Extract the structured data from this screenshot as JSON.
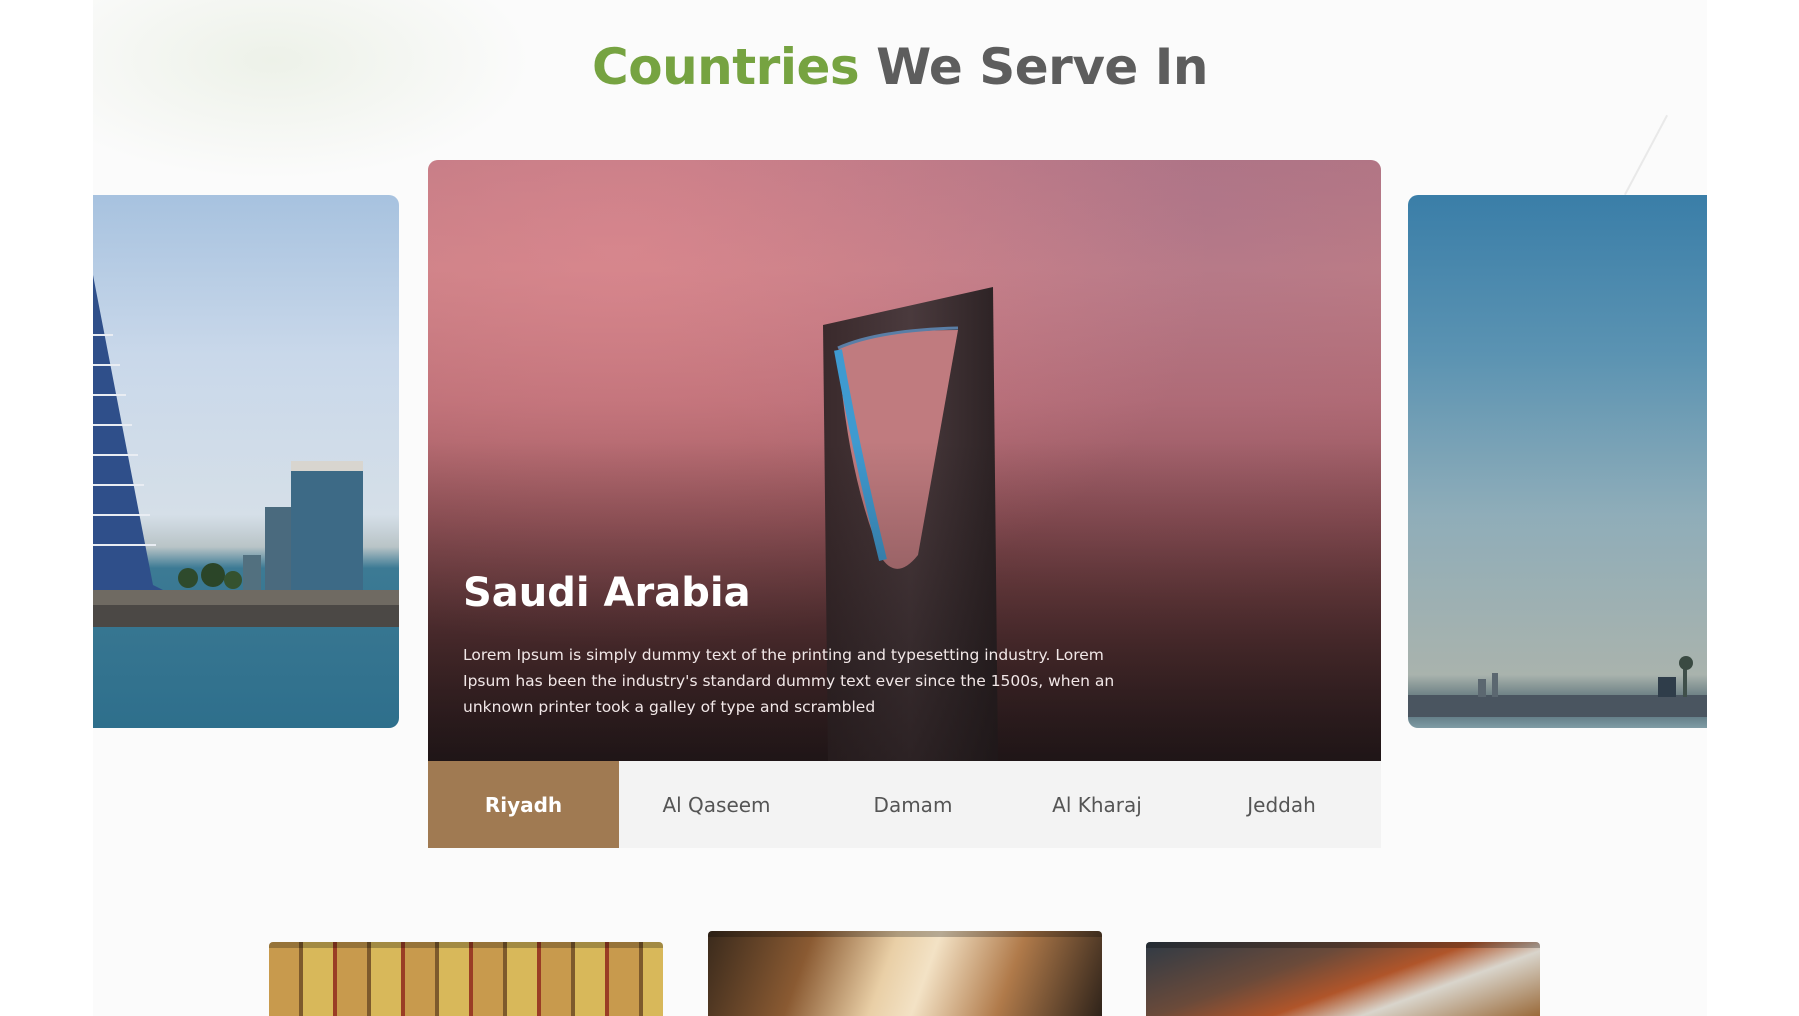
{
  "section": {
    "title_accent": "Countries",
    "title_rest": "We Serve In",
    "accent_color": "#76a341"
  },
  "hero": {
    "country": "Saudi Arabia",
    "description": "Lorem Ipsum is simply dummy text of the printing and typesetting industry. Lorem Ipsum has been the industry's standard dummy text ever since the 1500s, when an unknown printer took a galley of type and scrambled"
  },
  "tabs": [
    {
      "label": "Riyadh",
      "active": true
    },
    {
      "label": "Al Qaseem",
      "active": false
    },
    {
      "label": "Damam",
      "active": false
    },
    {
      "label": "Al Kharaj",
      "active": false
    },
    {
      "label": "Jeddah",
      "active": false
    }
  ],
  "colors": {
    "active_tab": "#a07a52",
    "tab_bar": "#f3f3f3"
  }
}
